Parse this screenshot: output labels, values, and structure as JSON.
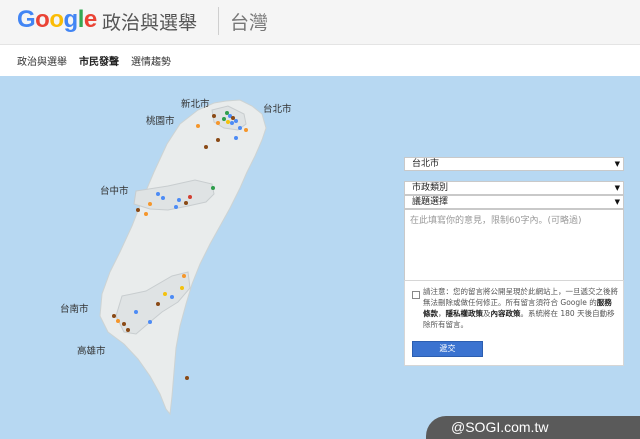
{
  "header": {
    "logo": {
      "G": "G",
      "o1": "o",
      "o2": "o",
      "g": "g",
      "l": "l",
      "e": "e"
    },
    "logo_colors": [
      "#4285f4",
      "#ea4335",
      "#fbbc05",
      "#4285f4",
      "#34a853",
      "#ea4335"
    ],
    "title": "政治與選舉",
    "region": "台灣"
  },
  "nav": {
    "items": [
      "政治與選舉",
      "市民發聲",
      "選情趨勢"
    ],
    "active": "市民發聲"
  },
  "map": {
    "cities": [
      "新北市",
      "台北市",
      "桃園市",
      "台中市",
      "台南市",
      "高雄市"
    ],
    "marker_colors": {
      "blue": "#4c8bf5",
      "orange": "#f5962b",
      "brown": "#8a4a16",
      "green": "#2e9d4c",
      "red": "#d23f31",
      "yellow": "#f4c20d"
    }
  },
  "form": {
    "city_select": "台北市",
    "category_select": "市政類別",
    "topic_select": "議題選擇",
    "comment_placeholder": "在此填寫你的意見，限制60字內。(可略過)",
    "notice_text": "請注意：您的留言將公開呈現於此網站上，一旦遞交之後將無法刪除或做任何修正。所有留言須符合 Google 的",
    "terms_link": "服務條款",
    "sep": "，",
    "privacy_link": "隱私權政策",
    "and": "及",
    "content_link": "內容政策",
    "notice_tail": "。系統將在 180 天後自動移除所有留言。",
    "submit_label": "遞交"
  },
  "watermark": "@SOGI.com.tw"
}
